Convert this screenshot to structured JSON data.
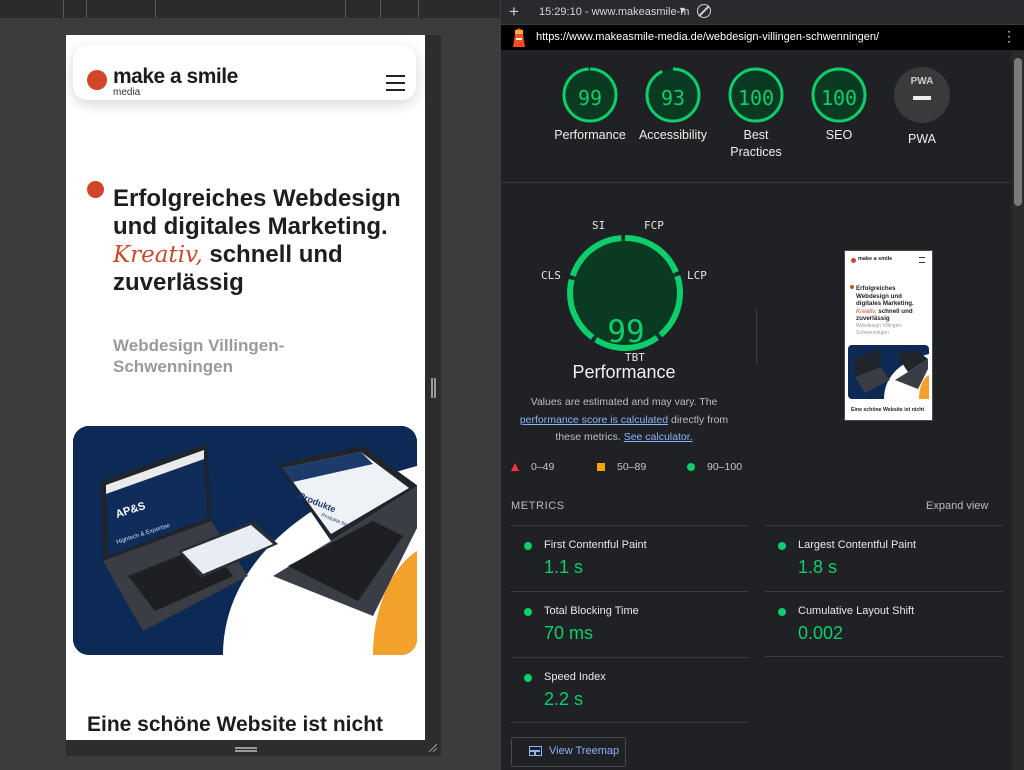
{
  "device_page": {
    "logo": {
      "text": "make a smile",
      "sub": "media"
    },
    "hero": {
      "heading_part1": "Erfolgreiches Webdesign und digitales Marketing. ",
      "heading_accent": "Kreativ,",
      "heading_part2": " schnell und zuverlässig",
      "subheading": "Webdesign Villingen-Schwenningen"
    },
    "hero_image": {
      "laptop_left_title": "AP&S",
      "laptop_left_sub": "Hightech & Expertise",
      "laptop_right_title": "Produkte",
      "laptop_right_sub": "Produkte für Nassprozesse"
    },
    "next_heading": "Eine schöne Website ist nicht"
  },
  "lighthouse": {
    "toolbar": {
      "report_label": "15:29:10 - www.makeasmile-m",
      "url": "https://www.makeasmile-media.de/webdesign-villingen-schwenningen/"
    },
    "categories": [
      {
        "label": "Performance",
        "score": "99",
        "fraction": 0.99
      },
      {
        "label": "Accessibility",
        "score": "93",
        "fraction": 0.93
      },
      {
        "label": "Best Practices",
        "score": "100",
        "fraction": 1.0
      },
      {
        "label": "SEO",
        "score": "100",
        "fraction": 1.0
      }
    ],
    "pwa": {
      "label": "PWA",
      "badge": "PWA"
    },
    "performance": {
      "score": "99",
      "fraction": 0.99,
      "title": "Performance",
      "gauge_labels": {
        "si": "SI",
        "fcp": "FCP",
        "cls": "CLS",
        "lcp": "LCP",
        "tbt": "TBT"
      },
      "note_prefix": "Values are estimated and may vary. The ",
      "note_link1": "performance score is calculated",
      "note_mid": " directly from these metrics. ",
      "note_link2": "See calculator."
    },
    "legend": {
      "fail": "0–49",
      "average": "50–89",
      "pass": "90–100"
    },
    "thumbnail": {
      "logo": "make a smile",
      "line1": "Erfolgreiches",
      "line2": "Webdesign und",
      "line3": "digitales Marketing.",
      "line4_accent": "Kreativ,",
      "line4_rest": " schnell und",
      "line5": "zuverlässig",
      "sub1": "Webdesign Villingen-",
      "sub2": "Schwenningen",
      "bottom": "Eine schöne Website ist nicht"
    },
    "metrics_title": "METRICS",
    "expand_view": "Expand view",
    "metrics": {
      "fcp": {
        "name": "First Contentful Paint",
        "value": "1.1 s"
      },
      "lcp": {
        "name": "Largest Contentful Paint",
        "value": "1.8 s"
      },
      "tbt": {
        "name": "Total Blocking Time",
        "value": "70 ms"
      },
      "cls": {
        "name": "Cumulative Layout Shift",
        "value": "0.002"
      },
      "si": {
        "name": "Speed Index",
        "value": "2.2 s"
      }
    },
    "treemap_button": "View Treemap",
    "colors": {
      "pass": "#0cce6b",
      "average": "#ffa400",
      "fail": "#ff3333",
      "link": "#8ab4f8",
      "brand_accent": "#d3452a"
    }
  }
}
